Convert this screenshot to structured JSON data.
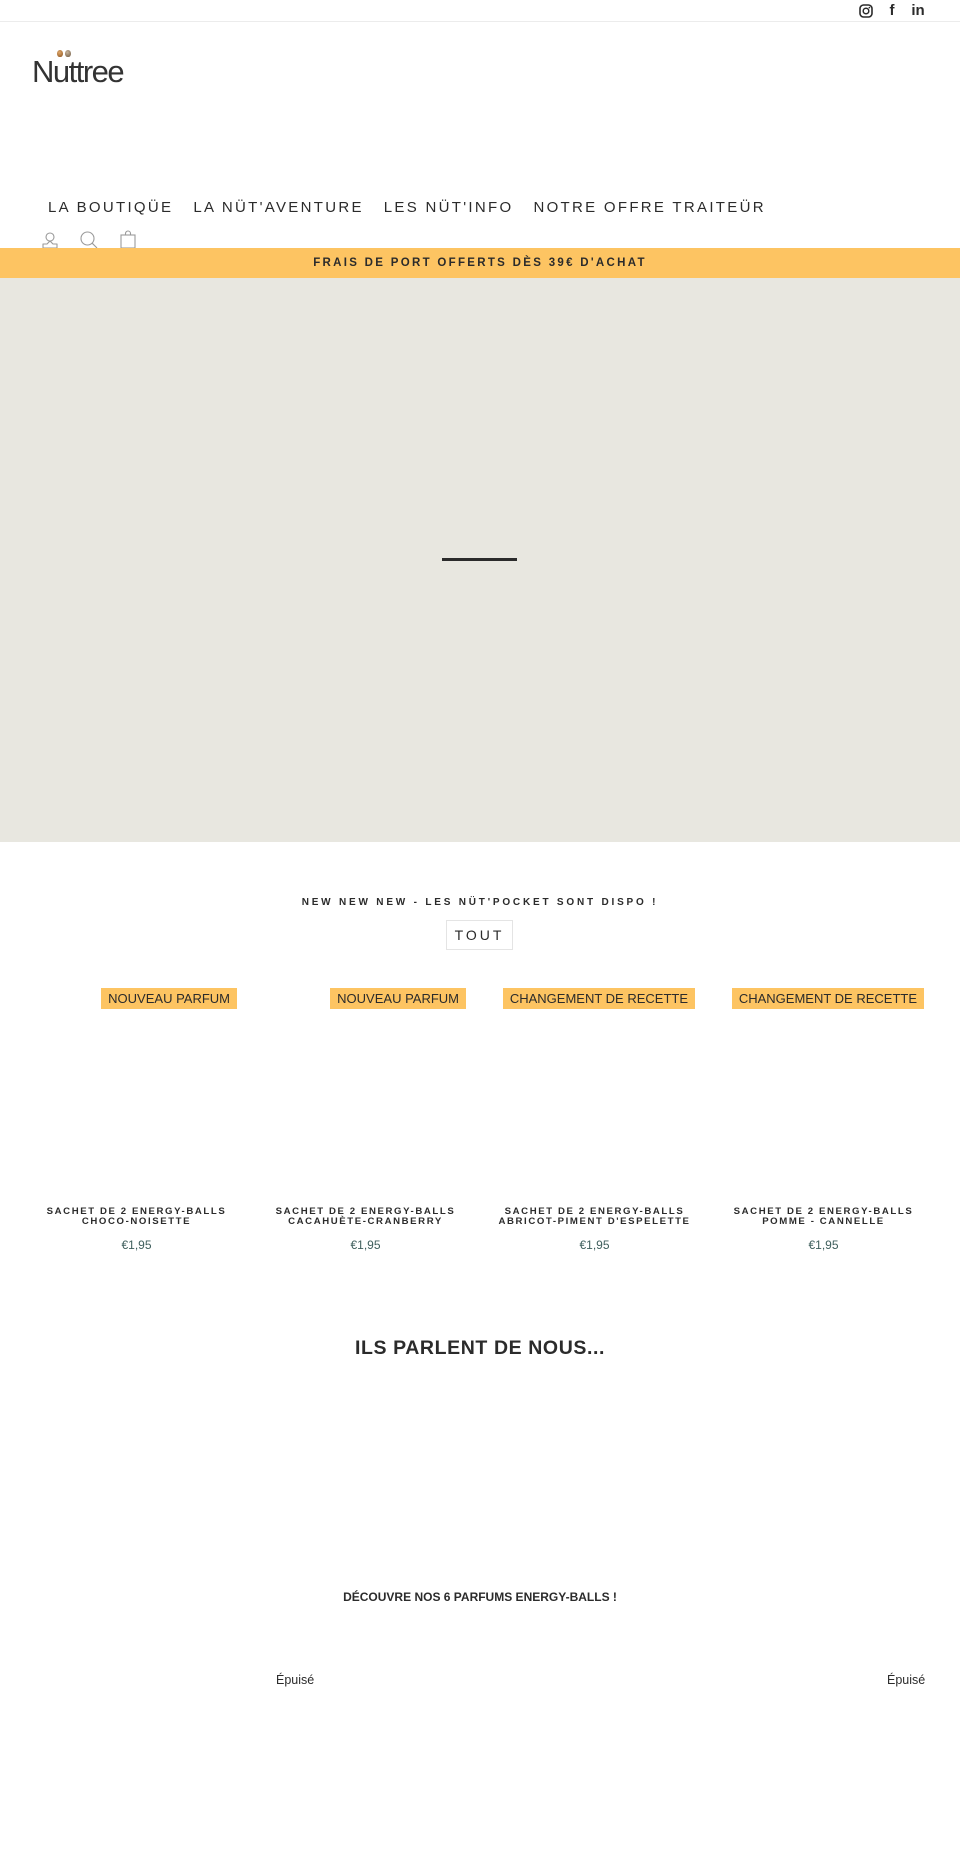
{
  "topbar": {
    "social": [
      {
        "name": "instagram-icon",
        "label": ""
      },
      {
        "name": "facebook-icon",
        "label": "f"
      },
      {
        "name": "linkedin-icon",
        "label": "in"
      }
    ]
  },
  "header": {
    "logo_text": "Nuttree",
    "nav": [
      {
        "label": "LA BOUTIQÜE"
      },
      {
        "label": "LA NÜT'AVENTURE"
      },
      {
        "label": "LES NÜT'INFO"
      },
      {
        "label": "NOTRE OFFRE TRAITEÜR"
      }
    ],
    "utility_icons": [
      "account-icon",
      "search-icon",
      "cart-icon"
    ]
  },
  "announcement": {
    "text": "FRAIS DE PORT OFFERTS DÈS 39€ D'ACHAT",
    "color": "#fdc462"
  },
  "hero": {
    "background": "#e8e7e0"
  },
  "collection": {
    "title": "NEW NEW NEW - LES NÜT'POCKET SONT DISPO !",
    "button_label": "TOUT",
    "products": [
      {
        "badge": "NOUVEAU PARFUM",
        "name_line1": "SACHET DE 2 ENERGY-BALLS",
        "name_line2": "CHOCO-NOISETTE",
        "price": "€1,95"
      },
      {
        "badge": "NOUVEAU PARFUM",
        "name_line1": "SACHET DE 2 ENERGY-BALLS",
        "name_line2": "CACAHUÈTE-CRANBERRY",
        "price": "€1,95"
      },
      {
        "badge": "CHANGEMENT DE RECETTE",
        "name_line1": "SACHET DE 2 ENERGY-BALLS",
        "name_line2": "ABRICOT-PIMENT D'ESPELETTE",
        "price": "€1,95"
      },
      {
        "badge": "CHANGEMENT DE RECETTE",
        "name_line1": "SACHET DE 2 ENERGY-BALLS",
        "name_line2": "POMME - CANNELLE",
        "price": "€1,95"
      }
    ]
  },
  "press": {
    "title": "ILS PARLENT DE NOUS..."
  },
  "flavors": {
    "title": "DÉCOUVRE NOS 6 PARFUMS ENERGY-BALLS !",
    "sold_out_labels": [
      "Épuisé",
      "Épuisé"
    ]
  }
}
